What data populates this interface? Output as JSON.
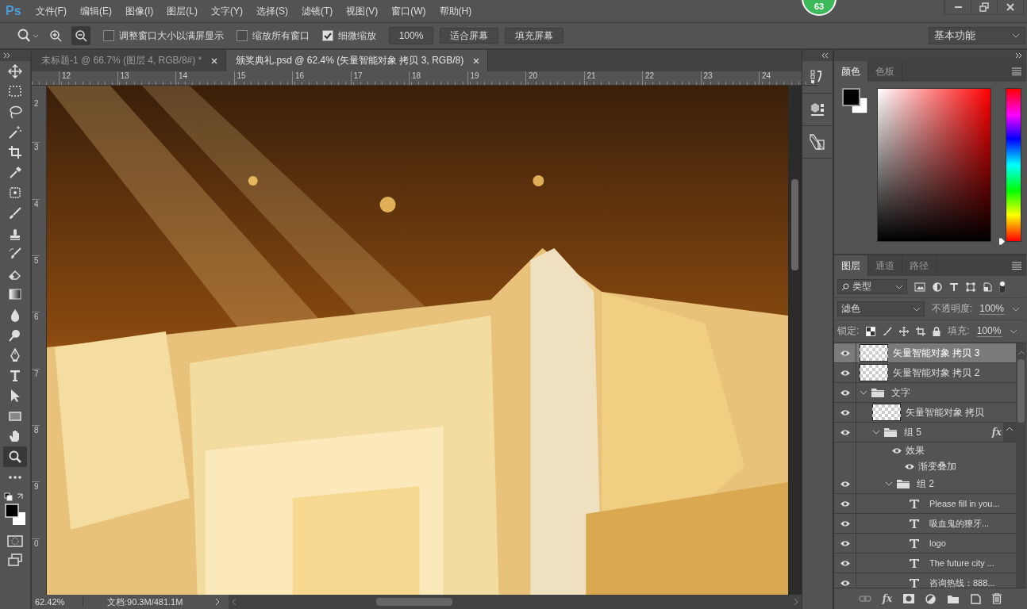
{
  "menu_bar": {
    "logo": "Ps",
    "items": [
      "文件(F)",
      "编辑(E)",
      "图像(I)",
      "图层(L)",
      "文字(Y)",
      "选择(S)",
      "滤镜(T)",
      "视图(V)",
      "窗口(W)",
      "帮助(H)"
    ]
  },
  "badge": {
    "count": "63"
  },
  "options_bar": {
    "checkboxes": [
      {
        "label": "调整窗口大小以满屏显示",
        "checked": false
      },
      {
        "label": "缩放所有窗口",
        "checked": false
      },
      {
        "label": "细微缩放",
        "checked": true
      }
    ],
    "zoom_value": "100%",
    "buttons": [
      "适合屏幕",
      "填充屏幕"
    ],
    "workspace": "基本功能"
  },
  "document_tabs": [
    {
      "title": "未标题-1 @ 66.7% (图层 4, RGB/8#) *",
      "selected": false
    },
    {
      "title": "颁奖典礼.psd @ 62.4% (矢量智能对象 拷贝 3, RGB/8)",
      "selected": true
    }
  ],
  "rulers": {
    "horizontal": [
      "12",
      "13",
      "14",
      "15",
      "16",
      "17",
      "18",
      "19",
      "20",
      "21",
      "22",
      "23",
      "24"
    ],
    "vertical": [
      "2",
      "3",
      "4",
      "5",
      "6",
      "7",
      "8",
      "9",
      "0"
    ]
  },
  "tools": [
    {
      "kind": "move",
      "selected": false
    },
    {
      "kind": "marquee",
      "selected": false
    },
    {
      "kind": "lasso",
      "selected": false
    },
    {
      "kind": "wand",
      "selected": false
    },
    {
      "kind": "crop",
      "selected": false
    },
    {
      "kind": "eyedropper",
      "selected": false
    },
    {
      "kind": "healing",
      "selected": false
    },
    {
      "kind": "brush",
      "selected": false
    },
    {
      "kind": "stamp",
      "selected": false
    },
    {
      "kind": "history-brush",
      "selected": false
    },
    {
      "kind": "eraser",
      "selected": false
    },
    {
      "kind": "gradient",
      "selected": false
    },
    {
      "kind": "blur",
      "selected": false
    },
    {
      "kind": "dodge",
      "selected": false
    },
    {
      "kind": "pen",
      "selected": false
    },
    {
      "kind": "type",
      "selected": false
    },
    {
      "kind": "select",
      "selected": false
    },
    {
      "kind": "rectangle",
      "selected": false
    },
    {
      "kind": "hand",
      "selected": false
    },
    {
      "kind": "zoom",
      "selected": true
    },
    {
      "kind": "more",
      "selected": false
    }
  ],
  "color_panel": {
    "tabs": [
      {
        "label": "颜色",
        "selected": true
      },
      {
        "label": "色板",
        "selected": false
      }
    ],
    "hue": {
      "level": 0
    }
  },
  "layers_panel": {
    "tabs": [
      {
        "label": "图层",
        "selected": true
      },
      {
        "label": "通道",
        "selected": false
      },
      {
        "label": "路径",
        "selected": false
      }
    ],
    "filter": "类型",
    "blend_mode": "滤色",
    "opacity_label": "不透明度:",
    "opacity": "100%",
    "lock_label": "锁定:",
    "fill_label": "填充:",
    "fill": "100%",
    "layers": [
      {
        "name": "矢量智能对象 拷贝 3",
        "kind": "smart",
        "selected": true
      },
      {
        "name": "矢量智能对象 拷贝 2",
        "kind": "smart",
        "selected": false
      },
      {
        "name": "文字",
        "kind": "group",
        "selected": false,
        "expanded": true,
        "children": [
          {
            "name": "矢量智能对象 拷贝",
            "kind": "smart",
            "selected": false
          },
          {
            "name": "组 5",
            "kind": "group",
            "selected": false,
            "expanded": true,
            "fx": "fx",
            "effects": {
              "label": "效果",
              "items": [
                "渐变叠加"
              ]
            },
            "children": [
              {
                "name": "组 2",
                "kind": "group",
                "selected": false,
                "expanded": true,
                "children": [
                  {
                    "name": "Please fill in you...",
                    "kind": "text",
                    "selected": false
                  },
                  {
                    "name": "吸血鬼的獠牙...",
                    "kind": "text",
                    "selected": false
                  },
                  {
                    "name": "logo",
                    "kind": "text",
                    "selected": false
                  },
                  {
                    "name": "The future city ...",
                    "kind": "text",
                    "selected": false
                  },
                  {
                    "name": "咨询热线：888...",
                    "kind": "text",
                    "selected": false
                  }
                ]
              }
            ]
          }
        ]
      }
    ],
    "footer_fx": "fx"
  },
  "status_bar": {
    "zoom": "62.42%",
    "doc_info": "文档:90.3M/481.1M"
  }
}
